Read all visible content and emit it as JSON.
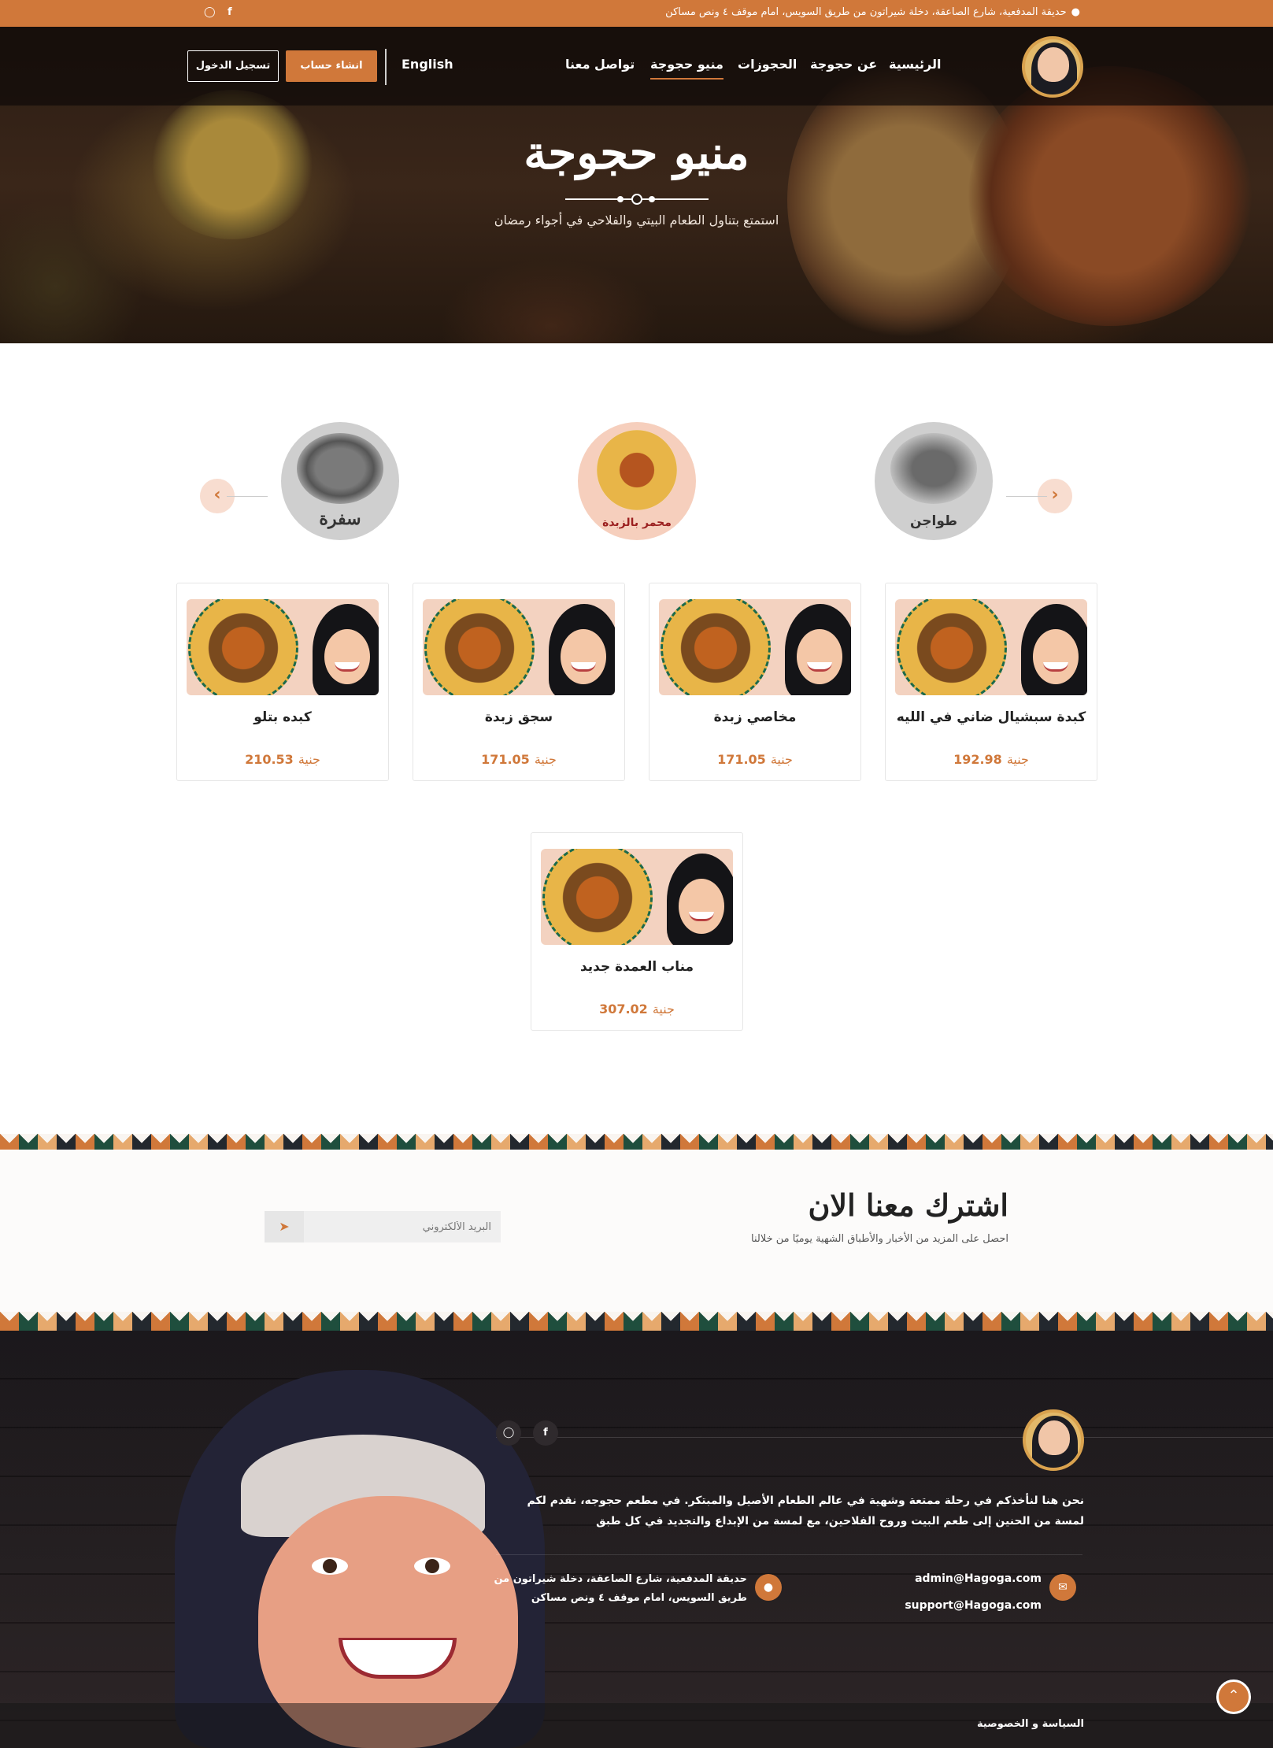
{
  "topbar": {
    "address": "حديقة المدفعية، شارع الصاعقة، دخلة شيراتون من طريق السويس، امام موقف ٤ ونص مساكن",
    "social": [
      "instagram-icon",
      "facebook-icon"
    ]
  },
  "nav": {
    "items": [
      "الرئيسية",
      "عن حجوجة",
      "الحجوزات",
      "منيو حجوجة",
      "تواصل معنا"
    ],
    "active": "منيو حجوجة",
    "language": "English",
    "register_label": "انشاء حساب",
    "login_label": "تسجيل الدخول"
  },
  "hero": {
    "title": "منيو حجوجة",
    "subtitle": "استمتع بتناول الطعام البيتي والفلاحي في أجواء رمضان"
  },
  "categories": [
    {
      "label": "طواجن",
      "active": false
    },
    {
      "label": "محمر بالزبدة",
      "active": true
    },
    {
      "label": "سفرة",
      "active": false
    }
  ],
  "currency": "جنية",
  "products": [
    {
      "name": "كبدة سبشيال ضاني في الليه",
      "price": "192.98"
    },
    {
      "name": "مخاصي زبدة",
      "price": "171.05"
    },
    {
      "name": "سجق زبدة",
      "price": "171.05"
    },
    {
      "name": "كبده بتلو",
      "price": "210.53"
    },
    {
      "name": "مناب العمدة جديد",
      "price": "307.02"
    }
  ],
  "subscribe": {
    "title": "اشترك معنا الان",
    "text": "احصل على المزيد من الأخبار والأطباق الشهية يوميًا من خلالنا",
    "placeholder": "البريد الألكتروني"
  },
  "footer": {
    "about": "نحن هنا لنأخذكم في رحلة ممتعة وشهية في عالم الطعام الأصيل والمبتكر. في مطعم حجوجه، نقدم لكم لمسة من الحنين إلى طعم البيت وروح الفلاحين، مع لمسة من الإبداع والتجديد في كل طبق",
    "emails": [
      "admin@Hagoga.com",
      "support@Hagoga.com"
    ],
    "address": "حديقة المدفعية، شارع الصاعقة، دخلة شيراتون من طريق السويس، امام موقف ٤ ونص مساكن",
    "policy": "السياسة و الخصوصية"
  },
  "colors": {
    "accent": "#d0783a",
    "dark": "#1c1719",
    "card_bg": "#f3d2c0"
  }
}
